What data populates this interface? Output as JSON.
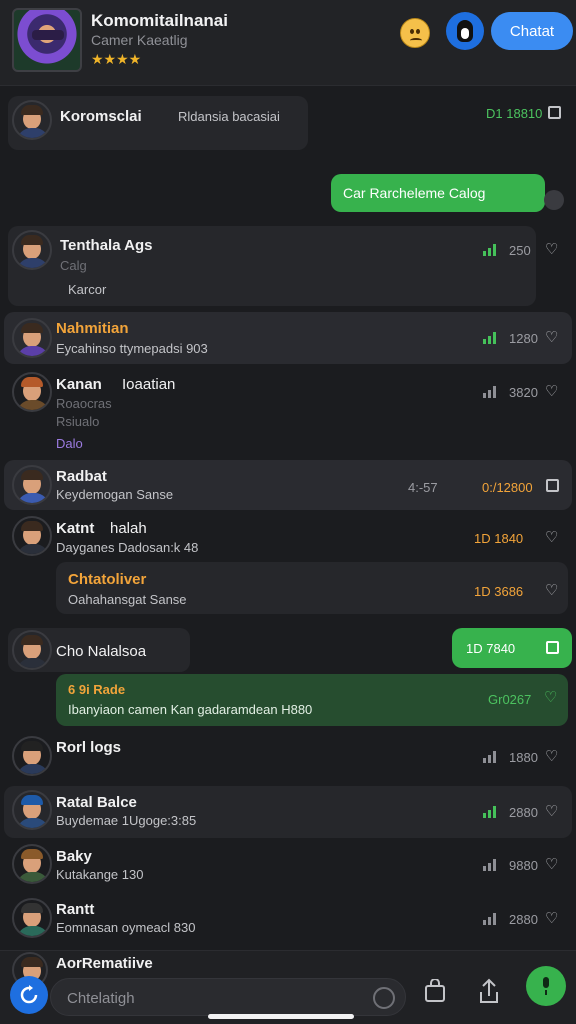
{
  "header": {
    "title": "Komomitailnanai",
    "subtitle": "Camer Kaeatlig",
    "rating": "★★★★",
    "action_label": "Chatat"
  },
  "chats": [
    {
      "name": "Koromsclai",
      "preview": "Rldansia bacasiai",
      "time": "D1 18810"
    },
    {
      "outgoing_text": "Car Rarcheleme Calog"
    },
    {
      "name": "Tenthala Ags",
      "preview": "Calg",
      "preview2": "Karcor",
      "time": "250"
    },
    {
      "name": "Nahmitian",
      "preview": "Eycahinso ttymepadsi 903",
      "time": "1280"
    },
    {
      "name": "Kanan",
      "name_extra": "Ioaatian",
      "preview": "Roaocras",
      "preview2": "Rsiualo",
      "tag": "Dalo",
      "time": "3820"
    },
    {
      "name": "Radbat",
      "preview": "Keydemogan Sanse",
      "time_left": "4:-57",
      "time": "0:/12800"
    },
    {
      "name": "Katnt",
      "name_extra": "halah",
      "preview": "Dayganes Dadosan:k 48",
      "time": "1D 1840"
    },
    {
      "name": "Chtatoliver",
      "preview": "Oahahansgat Sanse",
      "time": "1D 3686"
    },
    {
      "name": "Cho Nalalsoa",
      "time": "1D 7840"
    },
    {
      "name": "6 9i Rade",
      "preview": "Ibanyiaon camen Kan gadaramdean H880",
      "time": "Gr0267"
    },
    {
      "name": "Rorl logs",
      "time": "1880"
    },
    {
      "name": "Ratal Balce",
      "preview": "Buydemae 1Ugoge:3:85",
      "time": "2880"
    },
    {
      "name": "Baky",
      "preview": "Kutakange 130",
      "time": "9880"
    },
    {
      "name": "Rantt",
      "preview": "Eomnasan oymeacl 830",
      "time": "2880"
    }
  ],
  "peek_name": "AorRematiive",
  "composer": {
    "placeholder": "Chtelatigh"
  },
  "colors": {
    "accent": "#3b8cf2",
    "green": "#37b24d",
    "orange": "#f2a43a"
  }
}
